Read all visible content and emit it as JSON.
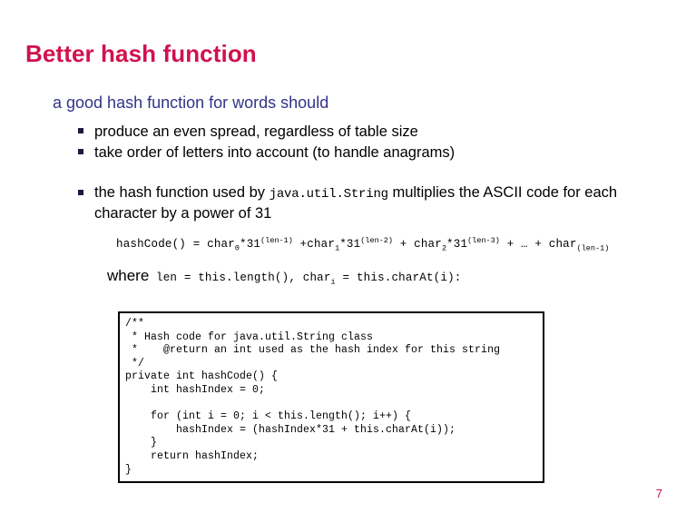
{
  "slide": {
    "title": "Better hash function",
    "page_number": "7",
    "title_color": "#D1114E",
    "subtitle_color": "#333388",
    "subtitle": "a good hash function for words should",
    "bullet_marker": "square-bullet",
    "bullets": [
      {
        "text": "produce an even spread, regardless of table size"
      },
      {
        "text": "take order of letters into account (to handle anagrams)"
      }
    ],
    "bullet_mixed": {
      "part1": "the hash function used by ",
      "code": "java.util.String",
      "part2": " multiplies the ASCII code for each character by a power of 31"
    },
    "formula": {
      "lhs": "hashCode() = char",
      "sub0": "0",
      "term0": "*31",
      "sup0": "(len-1)",
      "plus1": " +char",
      "sub1": "1",
      "term1": "*31",
      "sup1": "(len-2)",
      "plus2": " + char",
      "sub2": "2",
      "term2": "*31",
      "sup2": "(len-3)",
      "ellipsis": " + …  + char",
      "subn": "(len-1)"
    },
    "where": {
      "word": "where",
      "code_a": " len = this.length(), char",
      "sub_i": "i",
      "code_b": " = this.charAt(i):"
    },
    "code_block": "/**\n * Hash code for java.util.String class\n *    @return an int used as the hash index for this string\n */\nprivate int hashCode() {\n    int hashIndex = 0;\n\n    for (int i = 0; i < this.length(); i++) {\n        hashIndex = (hashIndex*31 + this.charAt(i));\n    }\n    return hashIndex;\n}"
  }
}
